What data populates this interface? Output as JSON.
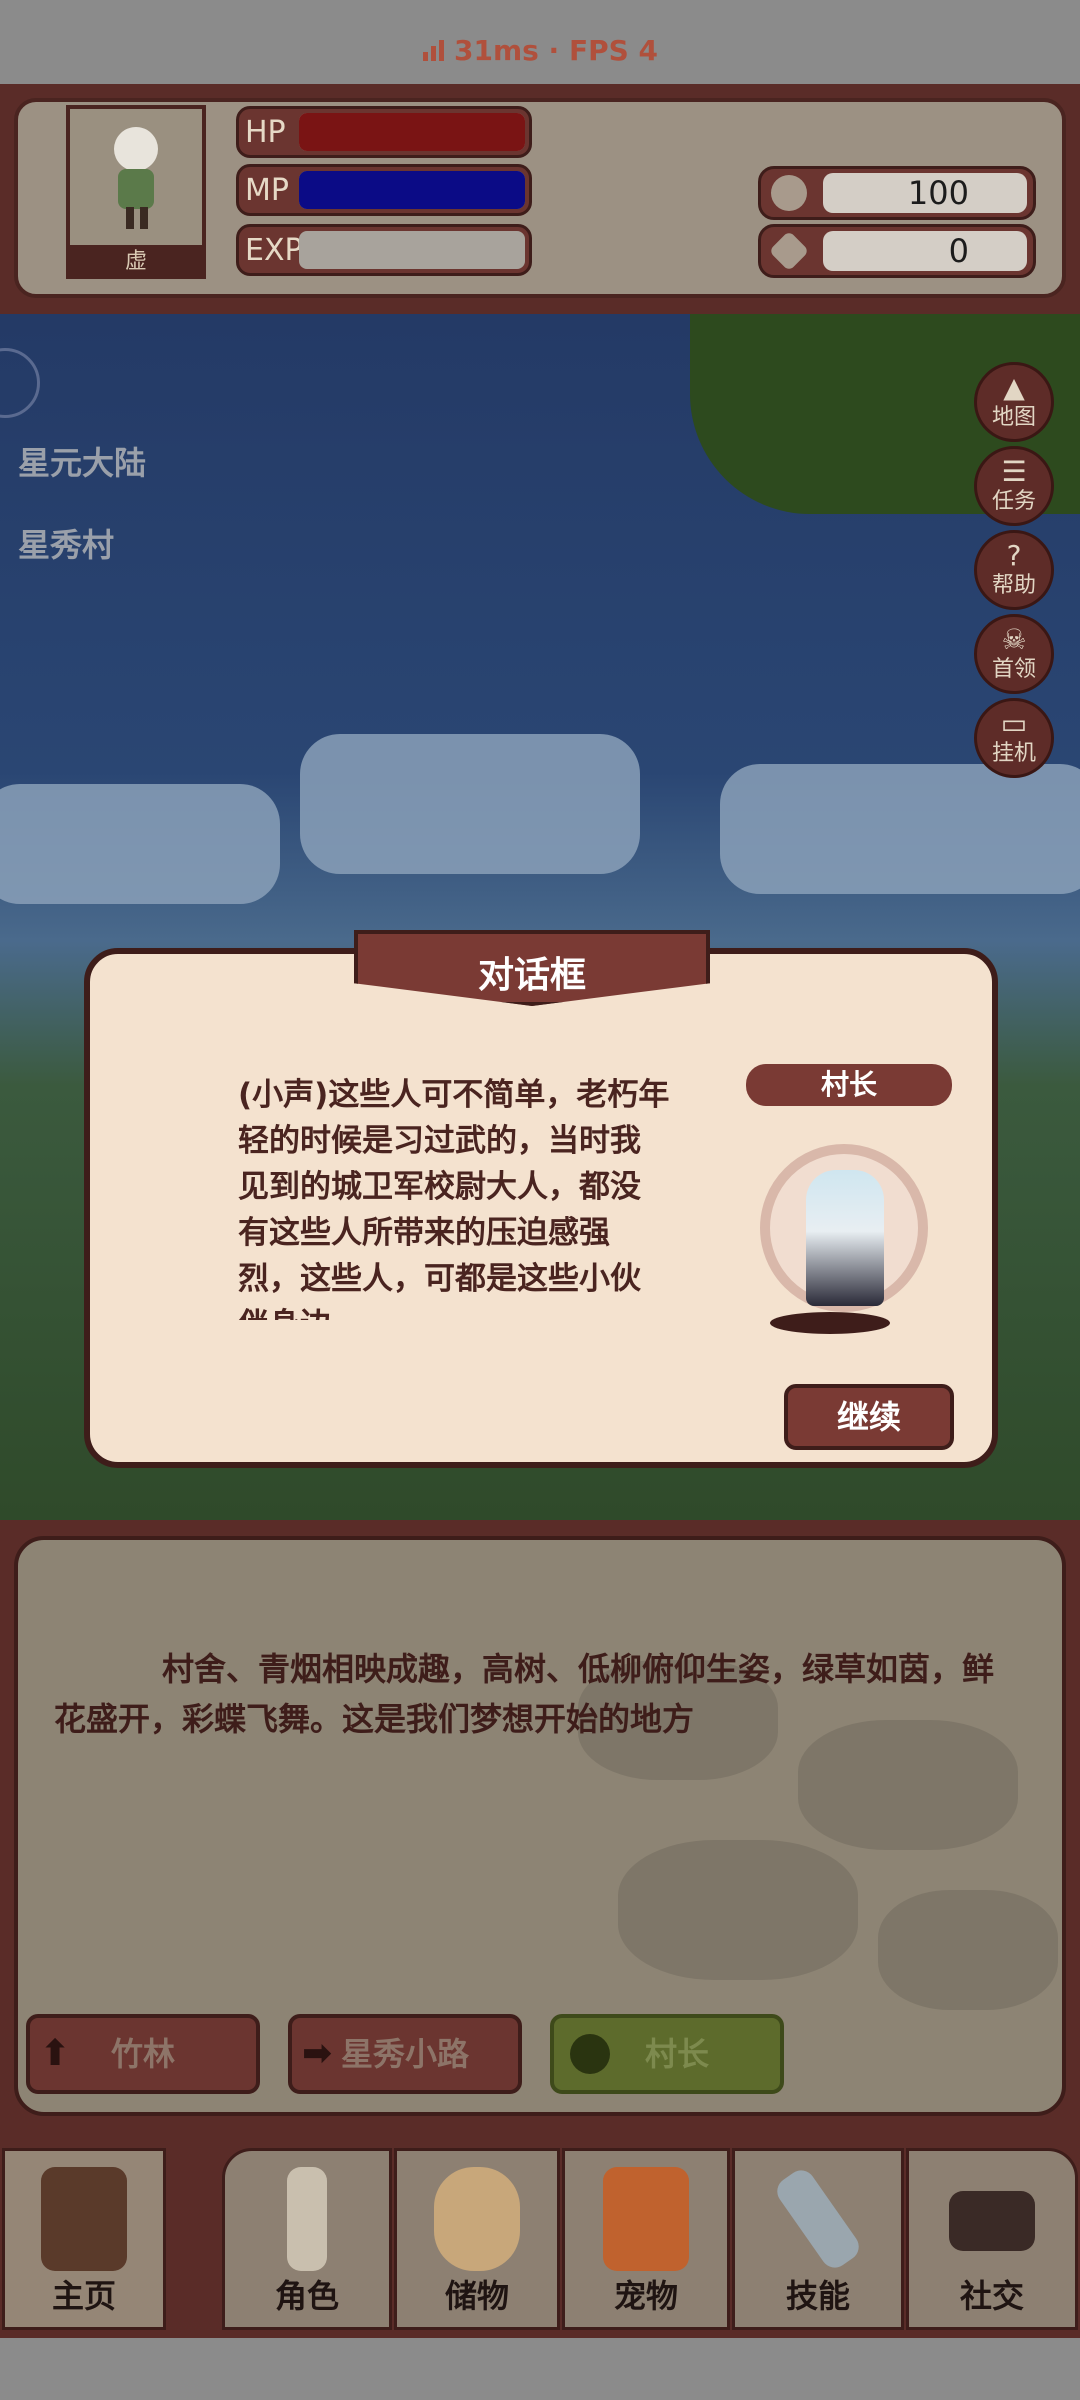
{
  "perf": {
    "ping": "31ms · FPS 4"
  },
  "player": {
    "avatar_label": "虚",
    "hp_label": "HP",
    "mp_label": "MP",
    "exp_label": "EXP",
    "hp_fraction": 1.0,
    "mp_fraction": 1.0,
    "exp_fraction": 0.0
  },
  "currency": {
    "coins": "100",
    "gems": "0"
  },
  "location": {
    "region": "星元大陆",
    "village": "星秀村"
  },
  "side_menu": [
    {
      "label": "地图",
      "icon": "mountain-icon"
    },
    {
      "label": "任务",
      "icon": "scroll-icon"
    },
    {
      "label": "帮助",
      "icon": "question-icon"
    },
    {
      "label": "首领",
      "icon": "demon-icon"
    },
    {
      "label": "挂机",
      "icon": "monitor-icon"
    }
  ],
  "dialog": {
    "title": "对话框",
    "speaker": "村长",
    "text": "(小声)这些人可不简单，老朽年轻的时候是习过武的，当时我见到的城卫军校尉大人，都没有这些人所带来的压迫感强烈，这些人，可都是这些小伙伴身边",
    "continue_label": "继续"
  },
  "description": {
    "text": "村舍、青烟相映成趣，高树、低柳俯仰生姿，绿草如茵，鲜花盛开，彩蝶飞舞。这是我们梦想开始的地方"
  },
  "exits": [
    {
      "label": "竹林",
      "icon": "arrow-up-icon"
    },
    {
      "label": "星秀小路",
      "icon": "arrow-right-icon"
    }
  ],
  "npc_button": {
    "label": "村长",
    "icon": "person-icon"
  },
  "tabs": [
    {
      "label": "主页",
      "icon": "gate-icon"
    },
    {
      "label": "角色",
      "icon": "figure-icon"
    },
    {
      "label": "储物",
      "icon": "bag-icon"
    },
    {
      "label": "宠物",
      "icon": "fox-icon"
    },
    {
      "label": "技能",
      "icon": "sword-icon"
    },
    {
      "label": "社交",
      "icon": "handshake-icon"
    }
  ],
  "colors": {
    "hp": "#7a1414",
    "mp": "#0b0b86",
    "frame": "#5a2c28",
    "npc_button": "#5d6b2c"
  }
}
